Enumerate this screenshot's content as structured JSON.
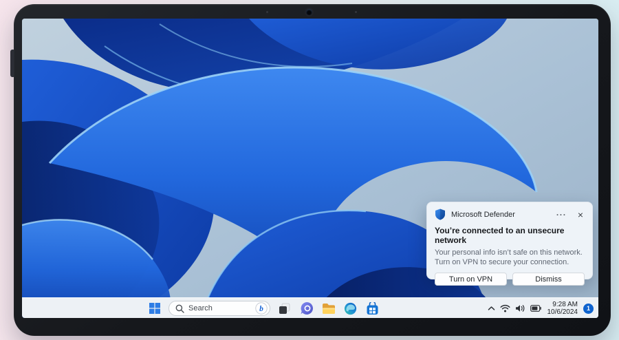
{
  "device": {
    "type": "tablet",
    "camera": "front-camera"
  },
  "notification": {
    "app_name": "Microsoft Defender",
    "title": "You’re connected to an unsecure network",
    "body": "Your personal info isn’t safe on this network. Turn on VPN to secure your connection.",
    "primary_button": "Turn on VPN",
    "secondary_button": "Dismiss",
    "more_icon": "···",
    "close_icon": "×"
  },
  "taskbar": {
    "search_placeholder": "Search",
    "app_icons": [
      "start",
      "search",
      "bing-copilot",
      "task-view",
      "chat",
      "file-explorer",
      "edge",
      "microsoft-store"
    ]
  },
  "tray": {
    "icons": [
      "hidden-icons-chevron",
      "wifi",
      "volume",
      "battery"
    ],
    "time": "9:28 AM",
    "date": "10/6/2024",
    "notification_count": "1"
  },
  "colors": {
    "accent_blue": "#2e7de5",
    "wallpaper_blue": "#1c59cf",
    "toast_bg": "#eef3f8",
    "taskbar_bg": "#edf1f5",
    "frame": "#17191d"
  }
}
